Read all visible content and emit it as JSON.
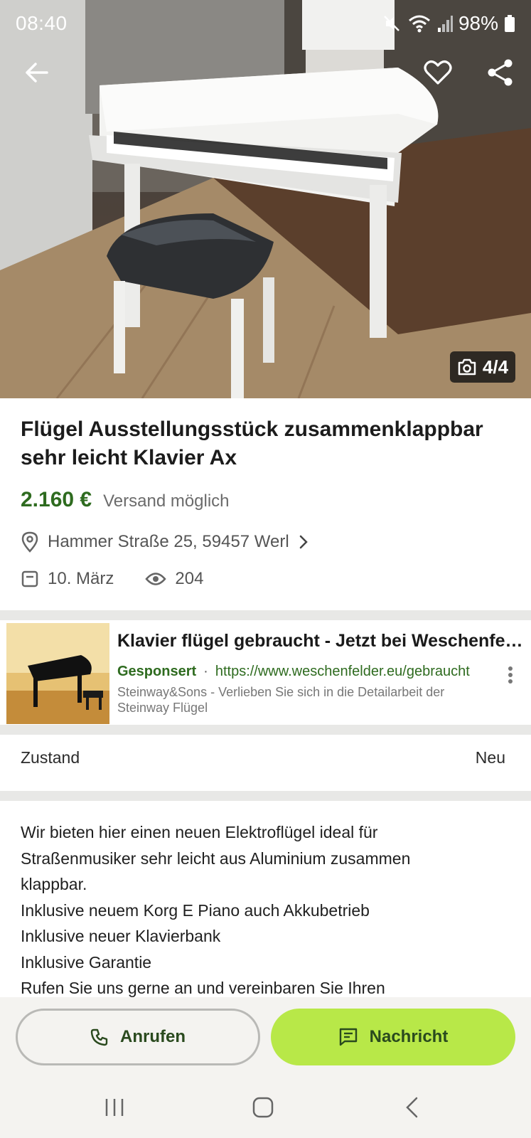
{
  "status_bar": {
    "time": "08:40",
    "battery": "98%",
    "icons": [
      "mute-icon",
      "wifi-icon",
      "signal-icon",
      "battery-icon"
    ]
  },
  "top_actions": {
    "icons": [
      "back-arrow-icon",
      "heart-icon",
      "share-icon"
    ]
  },
  "gallery": {
    "counter": "4/4",
    "icon": "camera-icon"
  },
  "listing": {
    "title": "Flügel Ausstellungsstück zusammenklappbar sehr leicht Klavier Ax",
    "price": "2.160 €",
    "shipping": "Versand möglich",
    "location": "Hammer Straße 25, 59457 Werl",
    "date": "10. März",
    "views": "204"
  },
  "ad": {
    "title": "Klavier flügel gebraucht - Jetzt bei Weschenfelder",
    "sponsor": "Gesponsert",
    "separator": "·",
    "url": "https://www.weschenfelder.eu/gebraucht",
    "description": "Steinway&Sons - Verlieben Sie sich in die Detailarbeit der Steinway Flügel"
  },
  "condition": {
    "label": "Zustand",
    "value": "Neu"
  },
  "description": {
    "lines": [
      "Wir bieten hier einen neuen Elektroflügel ideal für",
      "Straßenmusiker sehr leicht aus Aluminium zusammen",
      "klappbar.",
      "Inklusive neuem Korg E Piano auch Akkubetrieb",
      "Inklusive neuer Klavierbank",
      "Inklusive Garantie",
      "Rufen Sie uns gerne an und vereinbaren Sie Ihren"
    ]
  },
  "buttons": {
    "call": "Anrufen",
    "message": "Nachricht"
  },
  "colors": {
    "price_green": "#2e6b1f",
    "message_button": "#b8e848",
    "button_text": "#2a4a1e"
  }
}
